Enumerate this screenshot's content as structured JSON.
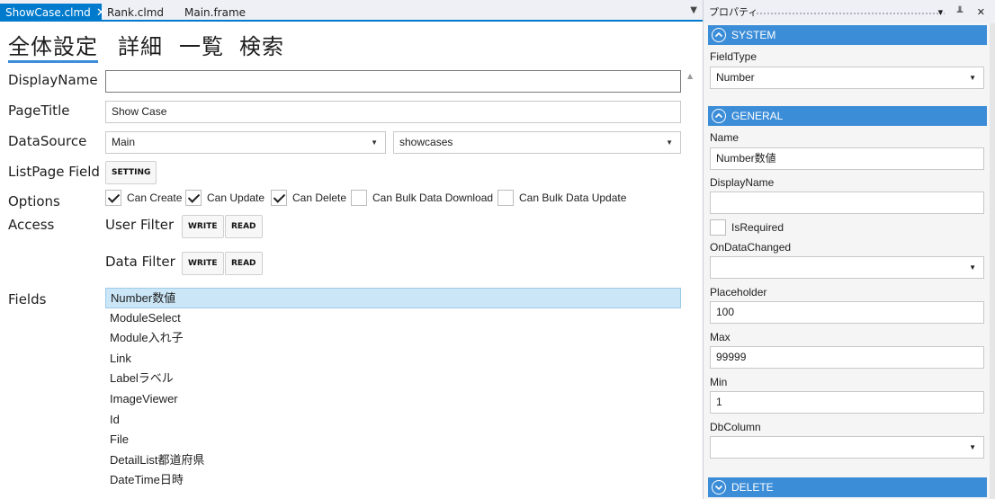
{
  "doc_tabs": [
    {
      "label": "ShowCase.clmd",
      "close": "✕"
    },
    {
      "label": "Rank.clmd"
    },
    {
      "label": "Main.frame"
    }
  ],
  "tab_menu_icon": "▼",
  "editor_tabs": [
    "全体設定",
    "詳細",
    "一覧",
    "検索"
  ],
  "form": {
    "display_name_label": "DisplayName",
    "display_name_value": "",
    "page_title_label": "PageTitle",
    "page_title_value": "Show Case",
    "data_source_label": "DataSource",
    "data_source_value": "Main",
    "data_source_table": "showcases",
    "listpage_field_label": "ListPage Field",
    "setting_button": "SETTING",
    "options_label": "Options",
    "options": [
      {
        "label": "Can Create",
        "checked": true
      },
      {
        "label": "Can Update",
        "checked": true
      },
      {
        "label": "Can Delete",
        "checked": true
      },
      {
        "label": "Can Bulk Data Download",
        "checked": false
      },
      {
        "label": "Can Bulk Data Update",
        "checked": false
      }
    ],
    "access_label": "Access",
    "user_filter_label": "User Filter",
    "data_filter_label": "Data Filter",
    "write_button": "WRITE",
    "read_button": "READ",
    "fields_label": "Fields",
    "fields": [
      "Number数値",
      "ModuleSelect",
      "Module入れ子",
      "Link",
      "Labelラベル",
      "ImageViewer",
      "Id",
      "File",
      "DetailList都道府県",
      "DateTime日時"
    ]
  },
  "props": {
    "title": "プロパティ",
    "controls": "▾ ╨ ✕",
    "sections": {
      "system": "SYSTEM",
      "general": "GENERAL",
      "delete": "DELETE"
    },
    "field_type_label": "FieldType",
    "field_type_value": "Number",
    "name_label": "Name",
    "name_value": "Number数値",
    "display_name_label": "DisplayName",
    "display_name_value": "",
    "is_required_label": "IsRequired",
    "is_required_checked": false,
    "on_data_changed_label": "OnDataChanged",
    "on_data_changed_value": "",
    "placeholder_label": "Placeholder",
    "placeholder_value": "100",
    "max_label": "Max",
    "max_value": "99999",
    "min_label": "Min",
    "min_value": "1",
    "db_column_label": "DbColumn",
    "db_column_value": ""
  },
  "colors": {
    "accent": "#007acc",
    "section": "#3c8dd8",
    "selection": "#cbe6f7"
  }
}
